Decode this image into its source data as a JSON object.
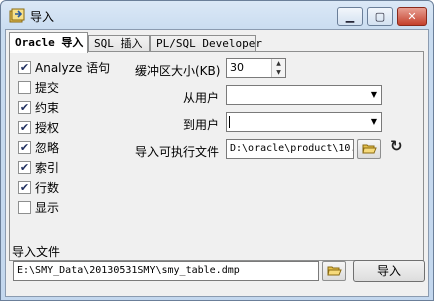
{
  "window": {
    "title": "导入"
  },
  "tabs": [
    {
      "label": "Oracle 导入",
      "active": true
    },
    {
      "label": "SQL 插入",
      "active": false
    },
    {
      "label": "PL/SQL Developer",
      "active": false
    }
  ],
  "options": [
    {
      "label": "Analyze 语句",
      "checked": true
    },
    {
      "label": "提交",
      "checked": false
    },
    {
      "label": "约束",
      "checked": true
    },
    {
      "label": "授权",
      "checked": true
    },
    {
      "label": "忽略",
      "checked": true
    },
    {
      "label": "索引",
      "checked": true
    },
    {
      "label": "行数",
      "checked": true
    },
    {
      "label": "显示",
      "checked": false
    }
  ],
  "buffer": {
    "label": "缓冲区大小(KB)",
    "value": "30"
  },
  "from_user": {
    "label": "从用户",
    "value": ""
  },
  "to_user": {
    "label": "到用户",
    "value": ""
  },
  "executable": {
    "label": "导入可执行文件",
    "value": "D:\\oracle\\product\\10."
  },
  "import_file": {
    "label": "导入文件",
    "value": "E:\\SMY_Data\\20130531SMY\\smy_table.dmp"
  },
  "import_button": {
    "label": "导入"
  },
  "icons": {
    "app": "import-icon",
    "folder": "folder-open-icon",
    "refresh": "refresh-icon",
    "min": "minimize-icon",
    "max": "maximize-icon",
    "close": "close-icon"
  }
}
